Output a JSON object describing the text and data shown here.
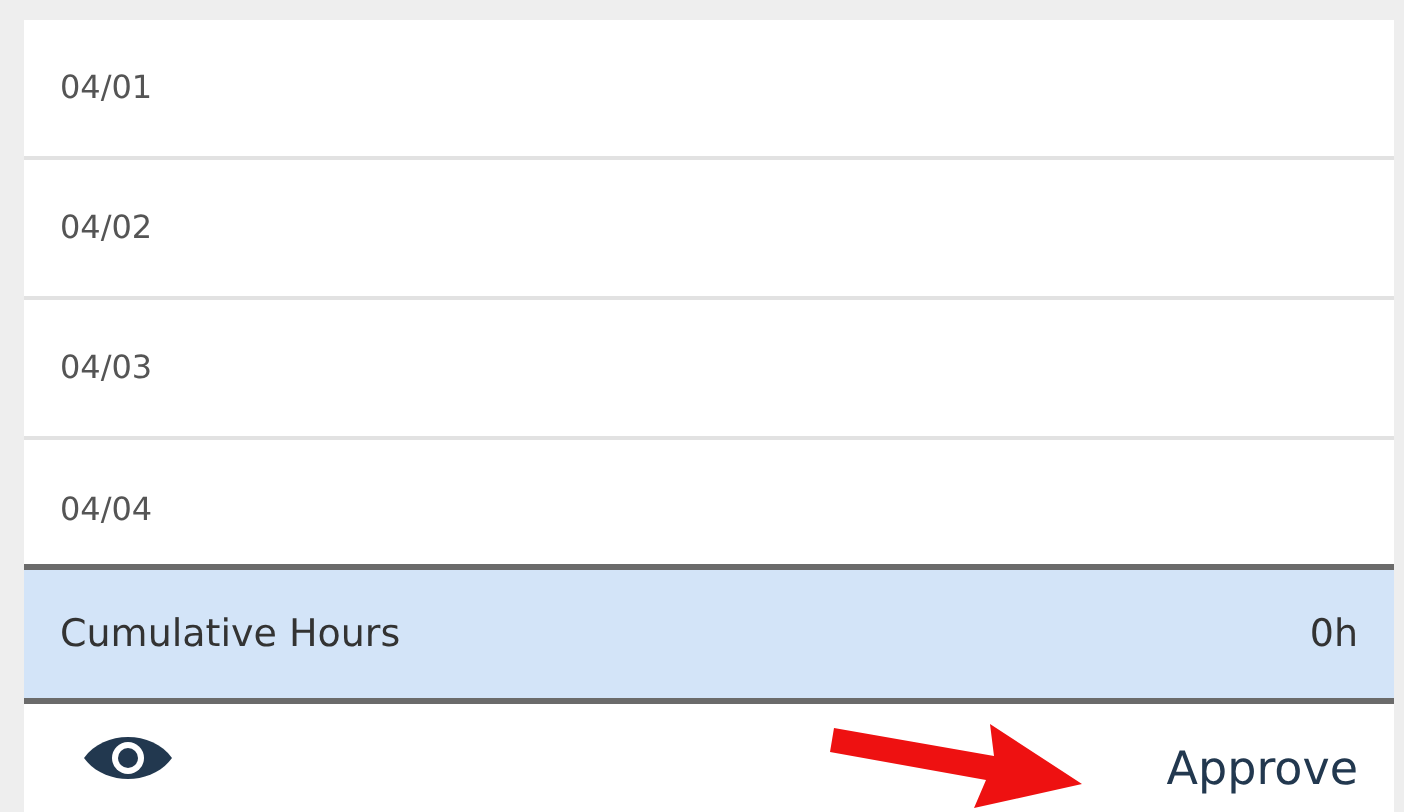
{
  "days": [
    {
      "date": "04/01"
    },
    {
      "date": "04/02"
    },
    {
      "date": "04/03"
    },
    {
      "date": "04/04"
    }
  ],
  "summary": {
    "label": "Cumulative Hours",
    "value": "0h"
  },
  "footer": {
    "action": "Approve"
  }
}
